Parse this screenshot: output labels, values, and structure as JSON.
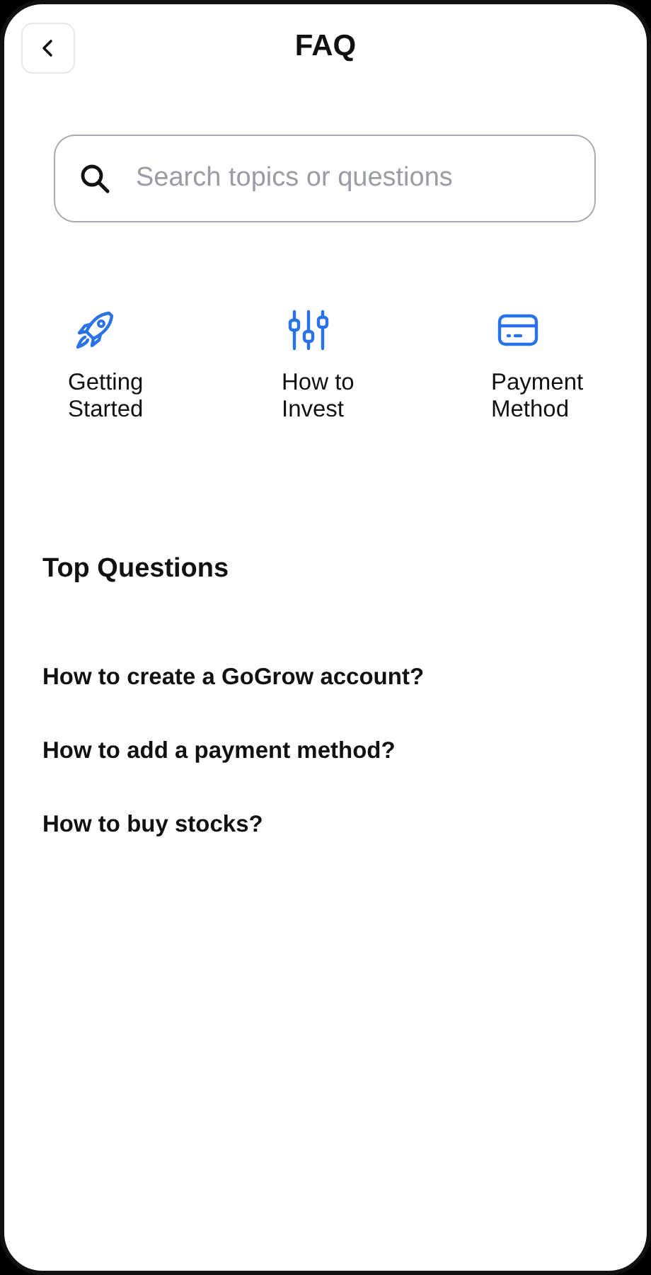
{
  "header": {
    "title": "FAQ"
  },
  "search": {
    "placeholder": "Search topics or questions"
  },
  "categories": [
    {
      "kind": "rocket",
      "label": "Getting Started"
    },
    {
      "kind": "sliders",
      "label": "How to Invest"
    },
    {
      "kind": "card",
      "label": "Payment Method"
    }
  ],
  "top_questions": {
    "title": "Top Questions",
    "items": [
      "How to create a GoGrow account?",
      "How to add a payment method?",
      "How to buy stocks?"
    ]
  }
}
